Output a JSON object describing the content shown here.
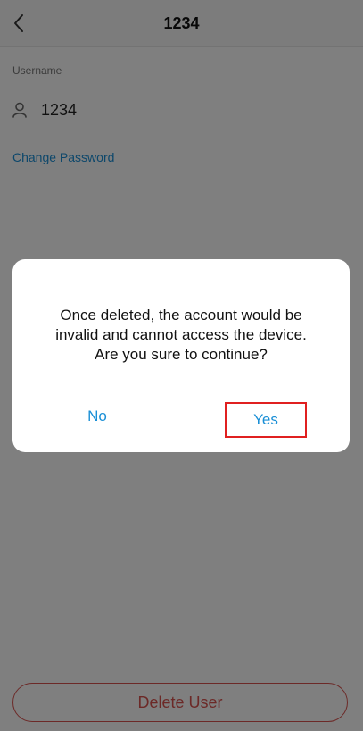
{
  "header": {
    "title": "1234",
    "back_icon": "chevron-left-icon"
  },
  "account": {
    "username_label": "Username",
    "username_value": "1234",
    "user_icon": "person-icon",
    "change_password_label": "Change Password"
  },
  "footer": {
    "delete_label": "Delete User"
  },
  "dialog": {
    "line1": "Once deleted, the account would be",
    "line2": "invalid and cannot access the device.",
    "line3": "Are you sure to continue?",
    "no_label": "No",
    "yes_label": "Yes"
  },
  "colors": {
    "accent": "#1a8fd6",
    "danger": "#d9534f",
    "highlight": "#e02020",
    "overlay": "rgba(0,0,0,0.5)"
  }
}
